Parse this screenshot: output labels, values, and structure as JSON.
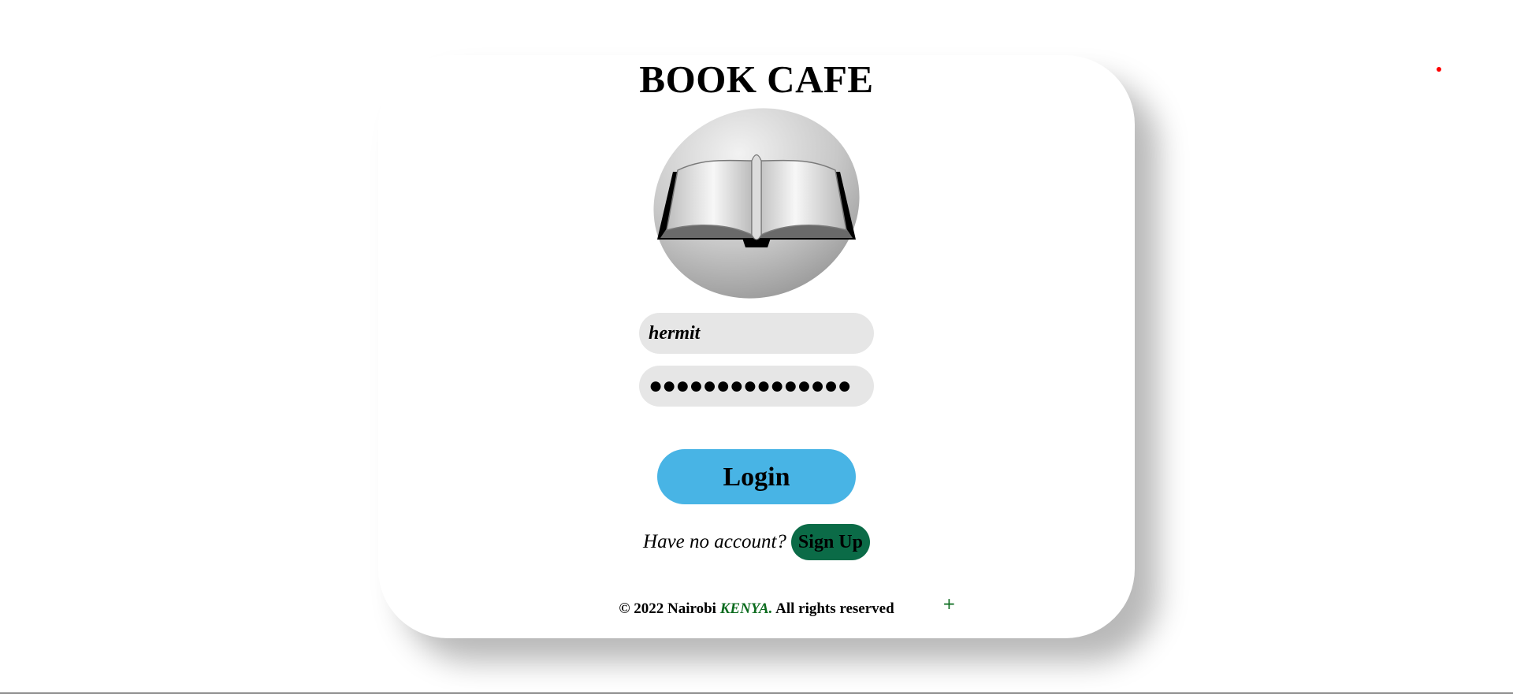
{
  "brand": {
    "title": "BOOK CAFE",
    "logo_icon": "open-book-icon"
  },
  "form": {
    "username_value": "hermit",
    "password_value": "●●●●●●●●●●●●●●●",
    "login_label": "Login"
  },
  "signup": {
    "prompt": "Have no account?",
    "button_label": "Sign Up"
  },
  "footer": {
    "prefix": "© 2022 Nairobi ",
    "country": "KENYA.",
    "suffix": " All rights reserved",
    "plus_glyph": "+"
  },
  "colors": {
    "login_button": "#48b4e5",
    "signup_button": "#0b6b47",
    "country_text": "#0b6b1e",
    "field_background": "#e6e6e6"
  }
}
